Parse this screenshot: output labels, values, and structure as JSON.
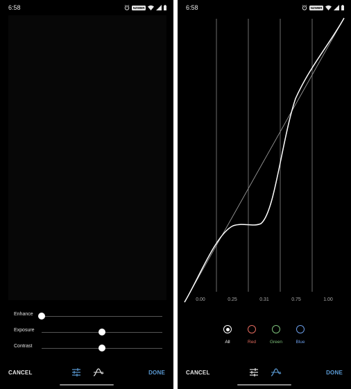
{
  "status_bar": {
    "time": "6:58",
    "badge": "NZWBR"
  },
  "left_screen": {
    "sliders": [
      {
        "label": "Enhance",
        "value": 0.0
      },
      {
        "label": "Exposure",
        "value": 0.5
      },
      {
        "label": "Contrast",
        "value": 0.5
      }
    ],
    "bottom_bar": {
      "cancel_label": "CANCEL",
      "done_label": "DONE",
      "active_tool": "adjust"
    }
  },
  "right_screen": {
    "curve_ticks": [
      "0.00",
      "0.25",
      "0.31",
      "0.75",
      "1.00"
    ],
    "channels": [
      {
        "label": "All",
        "color": "#ffffff",
        "selected": true
      },
      {
        "label": "Red",
        "color": "#e46a5e",
        "selected": false
      },
      {
        "label": "Green",
        "color": "#7dc07a",
        "selected": false
      },
      {
        "label": "Blue",
        "color": "#6a9be6",
        "selected": false
      }
    ],
    "bottom_bar": {
      "cancel_label": "CANCEL",
      "done_label": "DONE",
      "active_tool": "curves"
    }
  },
  "colors": {
    "accent": "#5b9bd5",
    "background": "#000000"
  }
}
